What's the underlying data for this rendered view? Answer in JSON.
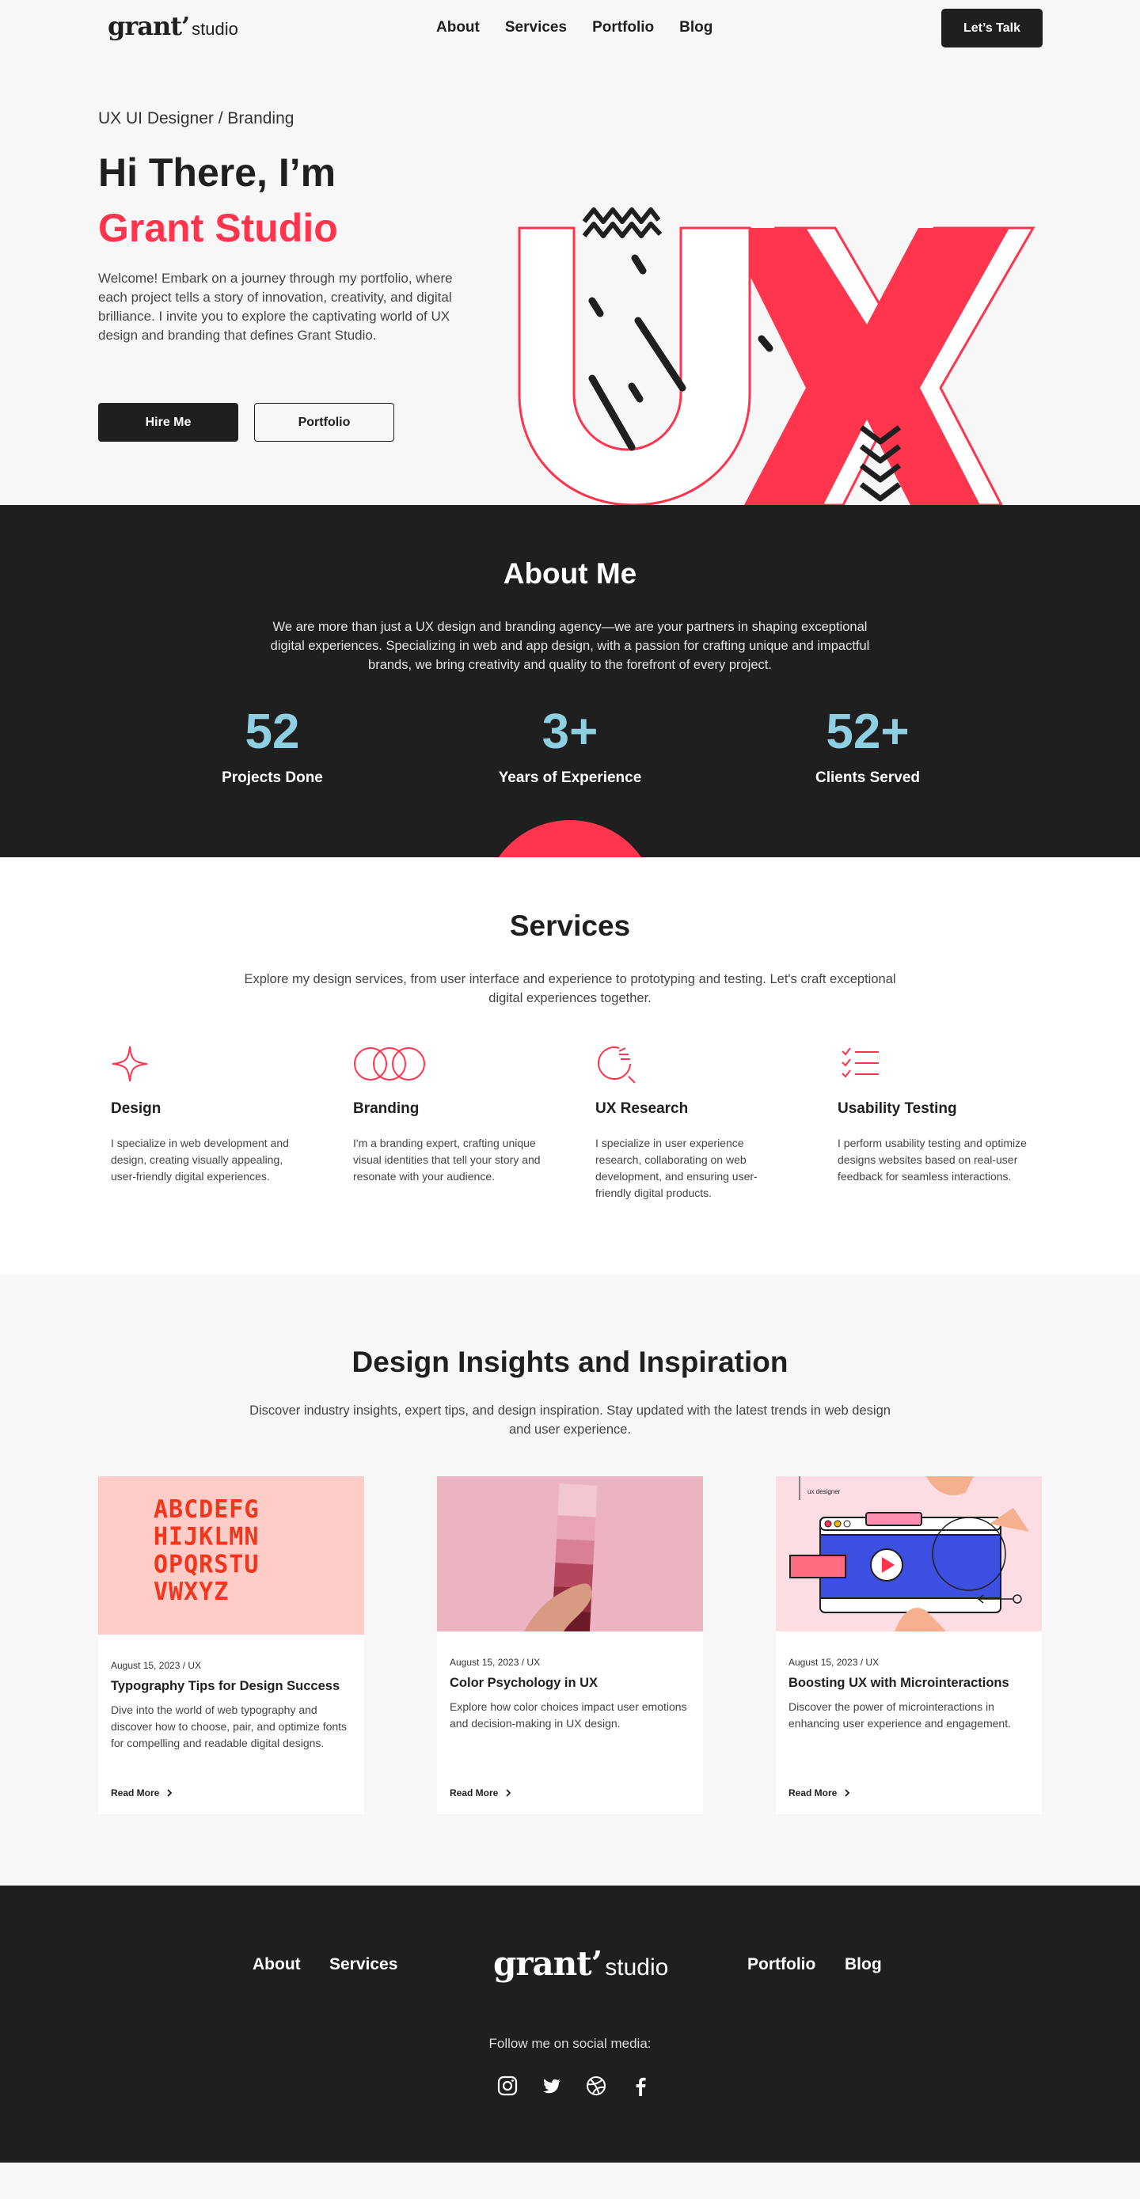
{
  "brand": {
    "logo_main": "grant’",
    "logo_sub": "studio"
  },
  "nav": {
    "links": [
      "About",
      "Services",
      "Portfolio",
      "Blog"
    ],
    "cta": "Let’s Talk"
  },
  "hero": {
    "subtitle": "UX UI Designer / Branding",
    "heading_line1": "Hi There, I’m",
    "heading_line2": "Grant Studio",
    "paragraph": "Welcome! Embark on a journey through my portfolio, where each project tells a story of innovation, creativity, and digital brilliance. I invite you to explore the captivating world of UX design and branding that defines Grant Studio.",
    "primary_button": "Hire Me",
    "secondary_button": "Portfolio",
    "art_letters": "UX"
  },
  "about": {
    "title": "About Me",
    "paragraph": "We are more than just a UX design and branding agency—we are your partners in shaping exceptional digital experiences. Specializing in web and app design, with a passion for crafting unique and impactful brands, we bring creativity and quality to the forefront of every project.",
    "stats": [
      {
        "value": "52",
        "label": "Projects Done"
      },
      {
        "value": "3+",
        "label": "Years of Experience"
      },
      {
        "value": "52+",
        "label": "Clients Served"
      }
    ]
  },
  "services": {
    "title": "Services",
    "intro": "Explore my design services, from user interface and experience to prototyping and testing. Let's craft exceptional digital experiences together.",
    "items": [
      {
        "icon": "sparkle-icon",
        "title": "Design",
        "text": "I specialize in web development and design, creating visually appealing, user-friendly digital experiences."
      },
      {
        "icon": "rings-icon",
        "title": "Branding",
        "text": "I'm a branding expert, crafting unique visual identities that tell your story and resonate with your audience."
      },
      {
        "icon": "research-icon",
        "title": "UX Research",
        "text": "I specialize in user experience research, collaborating on web development, and ensuring user-friendly digital products."
      },
      {
        "icon": "checklist-icon",
        "title": "Usability Testing",
        "text": "I perform usability testing and optimize designs websites based on real-user feedback for seamless interactions."
      }
    ]
  },
  "insights": {
    "title": "Design Insights and Inspiration",
    "intro": "Discover industry insights, expert tips, and design inspiration. Stay updated with the latest trends in web design and user experience.",
    "cards": [
      {
        "date": "August 15, 2023 / UX",
        "title": "Typography Tips for Design Success",
        "text": "Dive into the world of web typography and discover how to choose, pair, and optimize fonts for compelling and readable digital designs.",
        "link": "Read More",
        "image_text": [
          "ABCDEFG",
          "HIJKLMN",
          "OPQRSTU",
          "VWXYZ"
        ]
      },
      {
        "date": "August 15, 2023 / UX",
        "title": "Color Psychology in UX",
        "text": "Explore how color choices impact user emotions and decision-making in UX design.",
        "link": "Read More"
      },
      {
        "date": "August 15, 2023 / UX",
        "title": "Boosting UX with Microinteractions",
        "text": "Discover the power of microinteractions in enhancing user experience and engagement.",
        "link": "Read More",
        "image_text": [
          "ux designer"
        ]
      }
    ]
  },
  "footer": {
    "links_left": [
      "About",
      "Services"
    ],
    "links_right": [
      "Portfolio",
      "Blog"
    ],
    "follow": "Follow me on social media:",
    "socials": [
      "instagram-icon",
      "twitter-icon",
      "dribbble-icon",
      "facebook-icon"
    ]
  },
  "colors": {
    "accent": "#ff344d",
    "dark": "#1f1f1f",
    "stat": "#8ed0e1",
    "background": "#f7f7f7"
  }
}
